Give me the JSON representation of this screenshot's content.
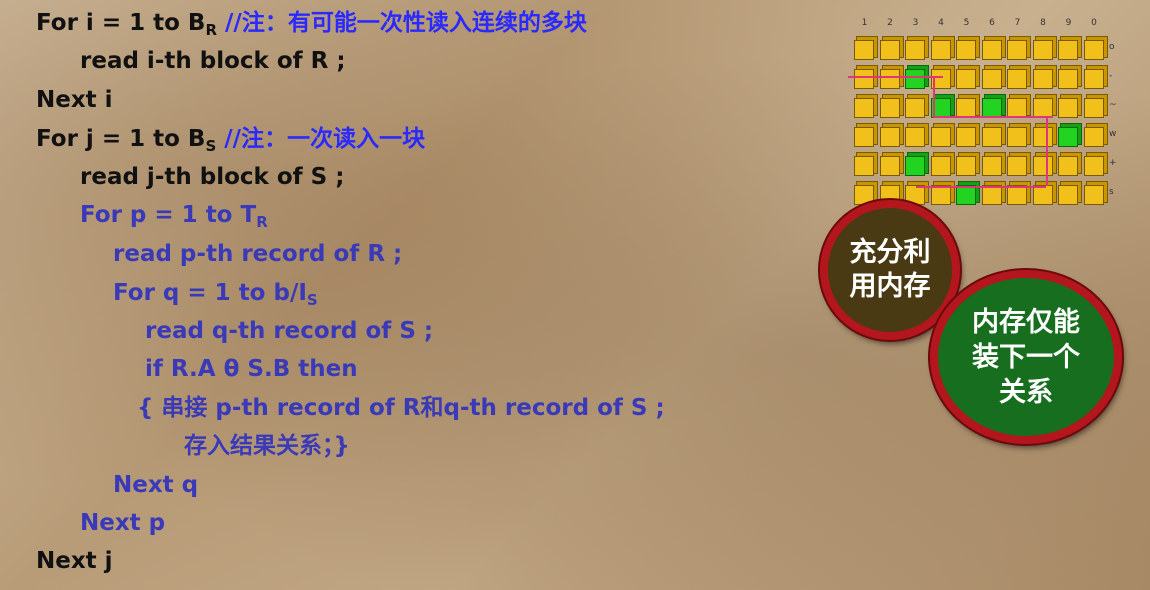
{
  "code": {
    "l1": {
      "prefix": "For  i = 1 to B",
      "sub": "R",
      "comment": " //注：有可能一次性读入连续的多块"
    },
    "l2": "read i-th block of R ;",
    "l3": "Next i",
    "l4": {
      "prefix": "For j = 1 to B",
      "sub": "S",
      "comment": "  //注：一次读入一块"
    },
    "l5": "read j-th block of S ;",
    "l6": {
      "prefix": "For  p = 1 to T",
      "sub": "R"
    },
    "l7": "read p-th record of R ;",
    "l8": {
      "prefix": "For q = 1 to b/I",
      "sub": "S"
    },
    "l9": "read q-th record of S ;",
    "l10": "if R.A θ S.B then",
    "l11": "{ 串接 p-th record of R和q-th record of S ;",
    "l12": "存入结果关系；}",
    "l13": "Next q",
    "l14": "Next p",
    "l15": "Next j"
  },
  "grid": {
    "column_numbers": [
      "1",
      "2",
      "3",
      "4",
      "5",
      "6",
      "7",
      "8",
      "9",
      "0"
    ],
    "row_numbers": [
      "o",
      "-",
      "~",
      "w",
      "+",
      "s"
    ],
    "green_cells": [
      [
        1,
        2
      ],
      [
        2,
        3
      ],
      [
        2,
        5
      ],
      [
        3,
        8
      ],
      [
        4,
        2
      ],
      [
        5,
        4
      ]
    ],
    "cube_color": "#f2c01a",
    "highlight_color": "#22d322"
  },
  "badges": {
    "memory_full": "充分利\n用内存",
    "fits_one_relation": "内存仅能\n装下一个\n关系"
  },
  "colors": {
    "text_black": "#111111",
    "text_blue": "#3a3ab8",
    "comment_blue": "#2a2aff",
    "badge_ring": "#b3161c",
    "badge1_fill": "#4a3a13",
    "badge2_fill": "#176e1f"
  }
}
